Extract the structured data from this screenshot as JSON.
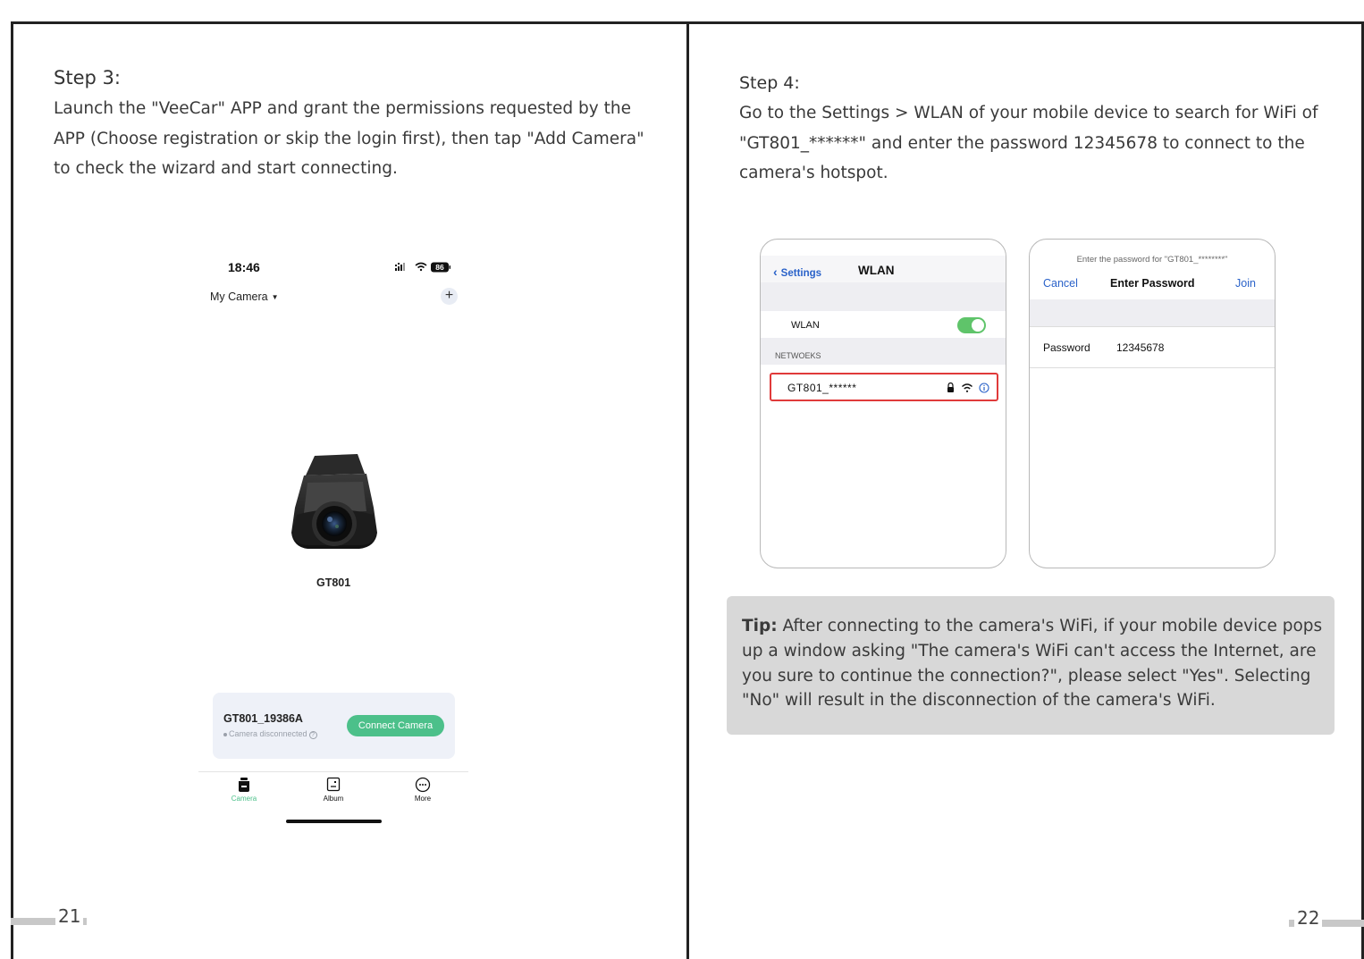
{
  "left_page": {
    "step_title": "Step 3:",
    "step_text": "Launch the \"VeeCar\" APP and grant the permissions requested by the APP (Choose registration or skip the login first), then tap \"Add Camera\" to check the wizard and start connecting.",
    "page_number": "21",
    "phone": {
      "time": "18:46",
      "battery": "86",
      "camera_selector": "My Camera",
      "camera_model": "GT801",
      "device_name": "GT801_19386A",
      "device_status": "Camera disconnected",
      "connect_button": "Connect Camera",
      "tabs": [
        "Camera",
        "Album",
        "More"
      ],
      "accent_color": "#4cc08a"
    }
  },
  "right_page": {
    "step_title": "Step 4:",
    "step_text": "Go to the Settings > WLAN of your mobile device to search for WiFi of \"GT801_******\" and enter the password 12345678 to connect to the camera's hotspot.",
    "page_number": "22",
    "wlan_screen": {
      "back_label": "Settings",
      "title": "WLAN",
      "wlan_label": "WLAN",
      "networks_header": "NETWOEKS",
      "network_name": "GT801_******",
      "highlight_color": "#e03a3a"
    },
    "password_screen": {
      "prompt": "Enter the password for \"GT801_********\"",
      "cancel": "Cancel",
      "title": "Enter Password",
      "join": "Join",
      "password_label": "Password",
      "password_value": "12345678"
    },
    "tip": {
      "label": "Tip:",
      "text": "After connecting to the camera's WiFi, if your mobile device pops up a window asking \"The camera's WiFi can't access the Internet, are you sure to continue the connection?\", please select \"Yes\". Selecting \"No\" will result in the disconnection of the camera's WiFi."
    }
  }
}
